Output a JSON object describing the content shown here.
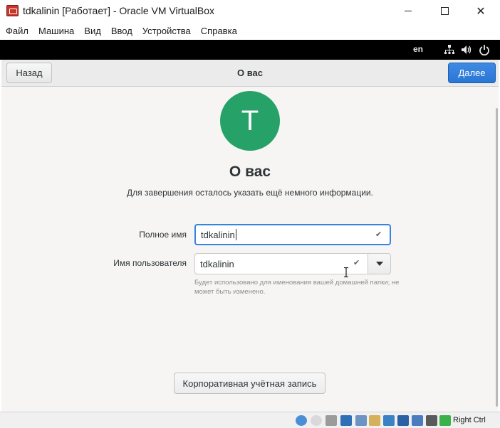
{
  "window": {
    "title": "tdkalinin [Работает] - Oracle VM VirtualBox",
    "close_glyph": "✕"
  },
  "menubar": {
    "items": [
      "Файл",
      "Машина",
      "Вид",
      "Ввод",
      "Устройства",
      "Справка"
    ]
  },
  "guest_topbar": {
    "language": "en",
    "icons": [
      "network-icon",
      "volume-icon",
      "power-icon"
    ]
  },
  "header": {
    "back_label": "Назад",
    "title": "О вас",
    "next_label": "Далее"
  },
  "main": {
    "avatar_letter": "T",
    "heading": "О вас",
    "subtitle": "Для завершения осталось указать ещё немного информации.",
    "full_name_label": "Полное имя",
    "full_name_value": "tdkalinin",
    "username_label": "Имя пользователя",
    "username_value": "tdkalinin",
    "username_hint": "Будет использовано для именования вашей домашней папки; не может быть изменено.",
    "enterprise_button": "Корпоративная учётная запись",
    "check_glyph": "✔"
  },
  "statusbar": {
    "host_key": "Right Ctrl",
    "icons": [
      "hard-disk-icon",
      "optical-drive-icon",
      "audio-icon",
      "network-adapter-icon",
      "usb-icon",
      "shared-folders-icon",
      "display-icon",
      "video-capture-icon",
      "virtualization-icon",
      "mouse-integration-icon"
    ]
  },
  "colors": {
    "accent": "#3584e4",
    "avatar": "#26a269",
    "guest_background": "#f6f5f4"
  }
}
